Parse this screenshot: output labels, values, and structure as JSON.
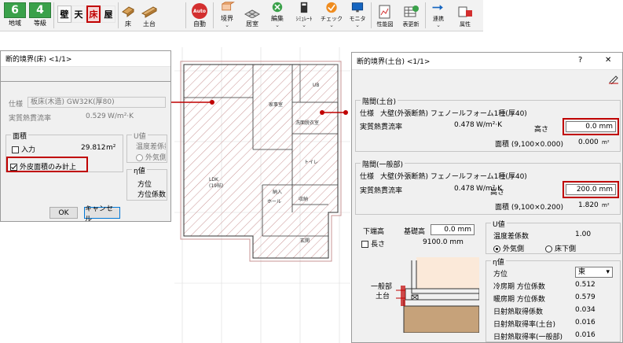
{
  "toolbar": {
    "region_num": "6",
    "region_label": "地域",
    "grade_num": "4",
    "grade_label": "等級",
    "wall": "壁",
    "ceiling": "天",
    "floor": "床",
    "roof": "屋",
    "floor_item": "床",
    "sill_item": "土台",
    "auto_badge": "Auto",
    "auto_label": "自動",
    "boundary": "境界",
    "room": "居室",
    "edit": "編集",
    "simulate": "ｼﾐｭﾚｰﾄ",
    "check": "チェック",
    "monitor": "モニタ",
    "perf_chart": "性能図",
    "table_update": "表更新",
    "link": "連携",
    "attr": "属性"
  },
  "left_dialog": {
    "title": "断的境界(床) <1/1>",
    "spec_label": "仕様",
    "spec_value": "板床(木造) GW32K(厚80)",
    "heat_label": "実質熱貫流率",
    "heat_value": "0.529",
    "heat_unit": "W/m²·K",
    "area_group": "面積",
    "input_label": "入力",
    "area_value": "29.812",
    "area_unit": "m²",
    "outer_only": "外皮面積のみ計上",
    "u_group": "U値",
    "temp_diff": "温度差係数",
    "outside": "外気側",
    "eta_group": "η値",
    "direction": "方位",
    "direction_coef": "方位係数",
    "ok": "OK",
    "cancel": "キャンセル"
  },
  "plan": {
    "rooms": [
      "家事室",
      "UB",
      "洗面脱衣室",
      "トイレ",
      "LDK",
      "(19帖)",
      "納入",
      "ホール",
      "収納",
      "玄関"
    ]
  },
  "right_dialog": {
    "title": "断的境界(土台) <1/1>",
    "help": "?",
    "close": "✕",
    "group1": "階間(土台)",
    "spec_label": "仕様",
    "spec1": "大壁(外張断熱) フェノールフォーム1種(厚40)",
    "heat_label": "実質熱貫流率",
    "heat1": "0.478",
    "heat_unit": "W/m²·K",
    "height_label": "高さ",
    "height1": "0.0 mm",
    "area_label1": "面積 (9,100×0.000)",
    "area1": "0.000",
    "area_unit": "m²",
    "group2": "階間(一般部)",
    "spec2": "大壁(外張断熱) フェノールフォーム1種(厚40)",
    "heat2": "0.478",
    "height2": "200.0 mm",
    "area_label2": "面積 (9,100×0.200)",
    "area2": "1.820",
    "lower_height": "下端高",
    "base_height": "基礎高",
    "base_value": "0.0 mm",
    "length_label": "長さ",
    "length_value": "9100.0 mm",
    "u_group": "U値",
    "temp_diff": "温度差係数",
    "temp_diff_val": "1.00",
    "outside": "外気側",
    "underfloor": "床下側",
    "eta_group": "η値",
    "direction": "方位",
    "direction_val": "東",
    "cooling_coef": "冷房期 方位係数",
    "cooling_val": "0.512",
    "heating_coef": "暖房期 方位係数",
    "heating_val": "0.579",
    "solar_coef": "日射熱取得係数",
    "solar_val": "0.034",
    "solar_sill": "日射熱取得率(土台)",
    "solar_sill_val": "0.016",
    "solar_gen": "日射熱取得率(一般部)",
    "solar_gen_val": "0.016",
    "diag_general": "一般部",
    "diag_sill": "土台"
  }
}
